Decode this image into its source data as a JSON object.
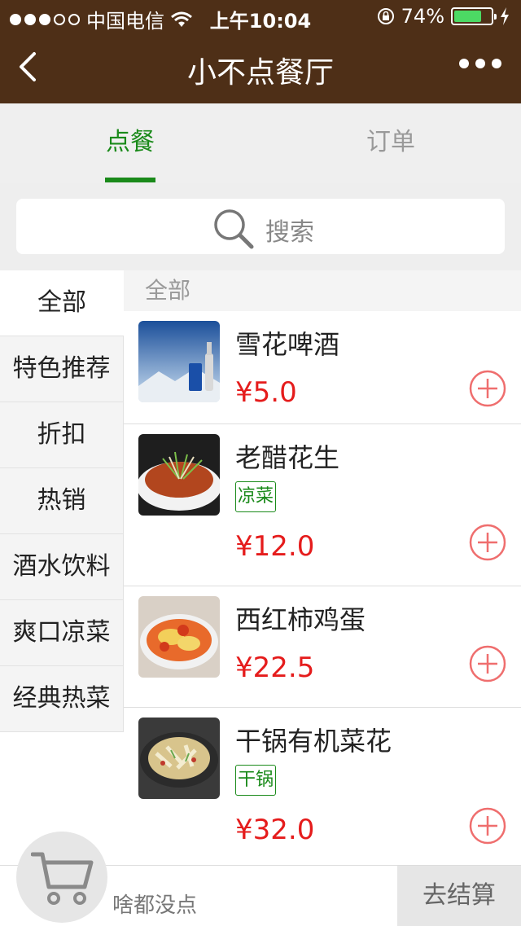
{
  "status_bar": {
    "carrier": "中国电信",
    "time": "上午10:04",
    "battery": "74%",
    "battery_level": 0.74
  },
  "nav": {
    "title": "小不点餐厅"
  },
  "tabs": [
    {
      "label": "点餐",
      "active": true
    },
    {
      "label": "订单",
      "active": false
    }
  ],
  "search": {
    "placeholder": "搜索"
  },
  "categories": [
    {
      "label": "全部",
      "active": true
    },
    {
      "label": "特色推荐"
    },
    {
      "label": "折扣"
    },
    {
      "label": "热销"
    },
    {
      "label": "酒水饮料"
    },
    {
      "label": "爽口凉菜"
    },
    {
      "label": "经典热菜"
    }
  ],
  "menu": {
    "section_title": "全部",
    "items": [
      {
        "name": "雪花啤酒",
        "tag": "",
        "price": "¥5.0"
      },
      {
        "name": "老醋花生",
        "tag": "凉菜",
        "price": "¥12.0"
      },
      {
        "name": "西红柿鸡蛋",
        "tag": "",
        "price": "¥22.5"
      },
      {
        "name": "干锅有机菜花",
        "tag": "干锅",
        "price": "¥32.0"
      }
    ]
  },
  "cart": {
    "empty_text": "啥都没点",
    "checkout_label": "去结算"
  },
  "colors": {
    "header": "#4e2f17",
    "accent_green": "#1a8a1a",
    "price_red": "#e51c1c",
    "add_icon": "#ef6e6e"
  }
}
